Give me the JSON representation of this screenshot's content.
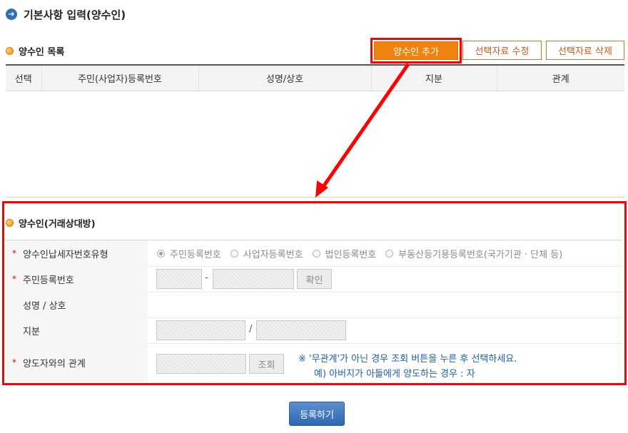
{
  "page": {
    "title": "기본사항 입력(양수인)"
  },
  "list_section": {
    "title": "양수인 목록",
    "buttons": {
      "add": "양수인 추가",
      "edit": "선택자료 수정",
      "delete": "선택자료 삭제"
    },
    "columns": [
      "선택",
      "주민(사업자)등록번호",
      "성명/상호",
      "지분",
      "관계"
    ]
  },
  "form_section": {
    "title": "양수인(거래상대방)",
    "rows": {
      "id_type": {
        "label": "양수인납세자번호유형",
        "options": [
          "주민등록번호",
          "사업자등록번호",
          "법인등록번호",
          "부동산등기용등록번호(국가기관 · 단체 등)"
        ],
        "selected": "주민등록번호"
      },
      "resident_no": {
        "label": "주민등록번호",
        "separator": "-",
        "confirm_button": "확인"
      },
      "name": {
        "label": "성명 / 상호"
      },
      "share": {
        "label": "지분",
        "separator": "/"
      },
      "relation": {
        "label": "양도자와의 관계",
        "lookup_button": "조회",
        "note_line1": "※ '무관계'가 아닌 경우 조회 버튼을 누른 후 선택하세요.",
        "note_line2": "예) 아버지가 아들에게 양도하는 경우 : 자"
      }
    }
  },
  "submit_button": "등록하기",
  "colors": {
    "highlight": "#ff0000",
    "primary_orange": "#f0820f",
    "submit_blue": "#2f66b0",
    "note_blue": "#1d5fa3"
  },
  "required_marker": "*"
}
